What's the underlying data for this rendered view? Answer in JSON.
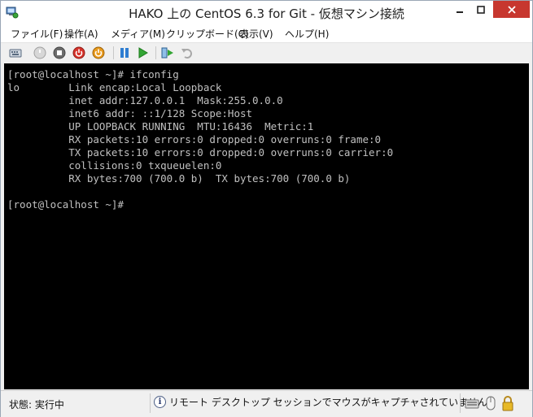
{
  "window": {
    "title": "HAKO 上の CentOS 6.3 for Git  - 仮想マシン接続"
  },
  "menu": [
    "ファイル(F)",
    "操作(A)",
    "メディア(M)",
    "クリップボード(C)",
    "表示(V)",
    "ヘルプ(H)"
  ],
  "toolbar": {
    "icons": [
      "ctrl-alt-del-icon",
      "start-icon",
      "turn-off-icon",
      "shutdown-icon",
      "power-icon",
      "pause-icon",
      "resume-icon",
      "snapshot-icon",
      "revert-icon"
    ]
  },
  "console": {
    "text": "[root@localhost ~]# ifconfig\nlo        Link encap:Local Loopback\n          inet addr:127.0.0.1  Mask:255.0.0.0\n          inet6 addr: ::1/128 Scope:Host\n          UP LOOPBACK RUNNING  MTU:16436  Metric:1\n          RX packets:10 errors:0 dropped:0 overruns:0 frame:0\n          TX packets:10 errors:0 dropped:0 overruns:0 carrier:0\n          collisions:0 txqueuelen:0\n          RX bytes:700 (700.0 b)  TX bytes:700 (700.0 b)\n\n[root@localhost ~]#"
  },
  "status": {
    "state": "状態: 実行中",
    "message": "リモート デスクトップ セッションでマウスがキャプチャされていません"
  },
  "colors": {
    "console_bg": "#000000",
    "console_fg": "#c0c0c0",
    "accent": "#2f7dd1"
  }
}
